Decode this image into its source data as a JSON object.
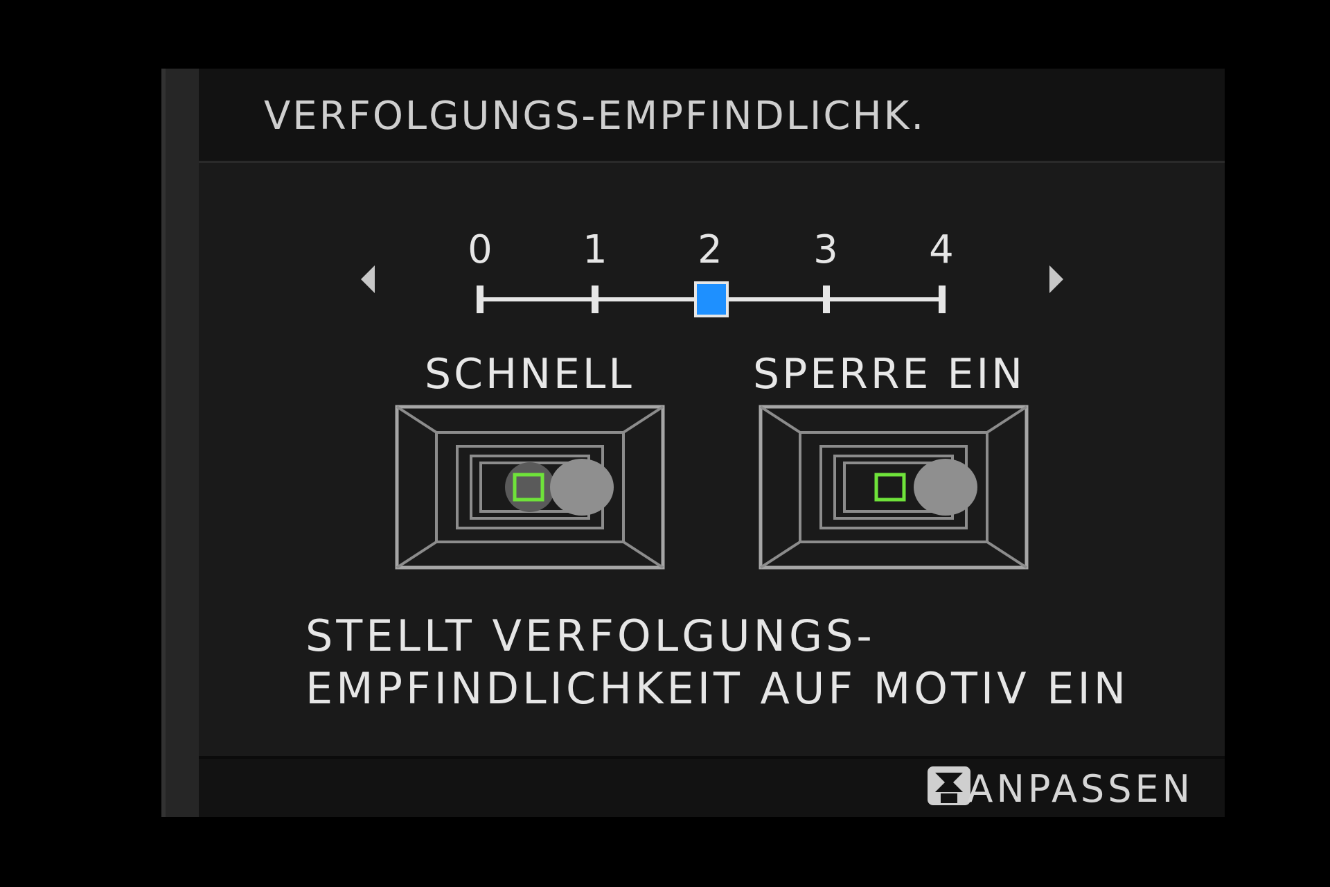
{
  "header": {
    "title": "VERFOLGUNGS-EMPFINDLICHK."
  },
  "slider": {
    "ticks": [
      "0",
      "1",
      "2",
      "3",
      "4"
    ],
    "selected_value": 2,
    "accent_color": "#1e90ff"
  },
  "modes": [
    {
      "label": "SCHNELL"
    },
    {
      "label": "SPERRE EIN"
    }
  ],
  "description": {
    "line1": "STELLT VERFOLGUNGS-",
    "line2": "EMPFINDLICHKEIT AUF MOTIV EIN"
  },
  "footer": {
    "icon": "custom-button-icon",
    "label": "ANPASSEN"
  },
  "colors": {
    "focus_frame": "#6fe33a",
    "subject": "#8f8f8f"
  }
}
